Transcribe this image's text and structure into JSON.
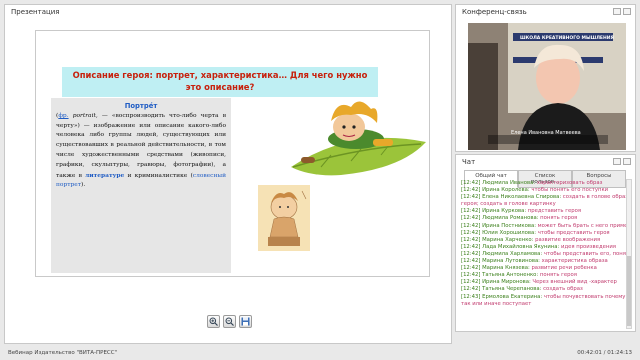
{
  "presentation": {
    "title": "Презентация",
    "slide": {
      "heading_line1": "Описание героя: портрет, характеристика… Для чего нужно",
      "heading_line2": "это описание?",
      "term": "Портре́т",
      "def_open": "(",
      "def_fr": "фр.",
      "def_word": "portrait,",
      "def_text": "— «воспроизводить что-либо черта в черту») — изображение или описание какого-либо человека либо группы людей, существующих или существовавших в реальной действительности, в том числе художественными средствами (живописи, графики, скульптуры, гравюры, фотографии), а также в",
      "def_lit": "литературе",
      "def_and": "и криминалистике (",
      "def_verbal": "словесный портрет",
      "def_close": ")."
    }
  },
  "conference": {
    "title": "Конференц-связь",
    "caption": "Елена Ивановна Матвеева",
    "banner": "ШКОЛА КРЕАТИВНОГО МЫШЛЕНИЯ"
  },
  "chat": {
    "title": "Чат",
    "tabs": [
      "Общий чат",
      "Список пользов...",
      "Вопросы"
    ],
    "messages": [
      {
        "time": "[12:42]",
        "name": "Людмила Иванова:",
        "text": "характеризовать образ"
      },
      {
        "time": "[12:42]",
        "name": "Ирина Королева:",
        "text": "чтобы понять его поступки"
      },
      {
        "time": "[12:42]",
        "name": "Елена Николаевна Спирова:",
        "text": "создать в голове образ"
      },
      {
        "time": "",
        "name": "",
        "text": "героя; создать в голове картинку"
      },
      {
        "time": "[12:42]",
        "name": "Ирина Куркова:",
        "text": "представить героя"
      },
      {
        "time": "[12:42]",
        "name": "Людмила Романова:",
        "text": "понять героя"
      },
      {
        "time": "[12:42]",
        "name": "Ирина Постникова:",
        "text": "может быть брать с него пример"
      },
      {
        "time": "[12:42]",
        "name": "Юлия Хорошилова:",
        "text": "чтобы представить героя"
      },
      {
        "time": "[12:42]",
        "name": "Марина Харченко:",
        "text": "развитие воображения"
      },
      {
        "time": "[12:42]",
        "name": "Лада Михайловна Якунина:",
        "text": "идея произведения"
      },
      {
        "time": "[12:42]",
        "name": "Людмила Харламова:",
        "text": "чтобы представить его, понять"
      },
      {
        "time": "[12:42]",
        "name": "Марина Лутовинова:",
        "text": "характеристика образа"
      },
      {
        "time": "[12:42]",
        "name": "Марина Князева:",
        "text": "развитие речи ребенка"
      },
      {
        "time": "[12:42]",
        "name": "Татьяна Антоненко:",
        "text": "понять героя"
      },
      {
        "time": "[12:42]",
        "name": "Ирина Миронова:",
        "text": "Через внешний вид -характер"
      },
      {
        "time": "[12:42]",
        "name": "Татьяна Черепанова:",
        "text": "создать образ"
      },
      {
        "time": "[12:43]",
        "name": "Ермолова Екатерина:",
        "text": "чтобы почувствовать почему герой"
      },
      {
        "time": "",
        "name": "",
        "text": "так или иначе поступает"
      }
    ]
  },
  "footer": {
    "left": "Вебинар Издательство \"ВИТА-ПРЕСС\"",
    "right": "00:42:01 / 01:24:13"
  }
}
